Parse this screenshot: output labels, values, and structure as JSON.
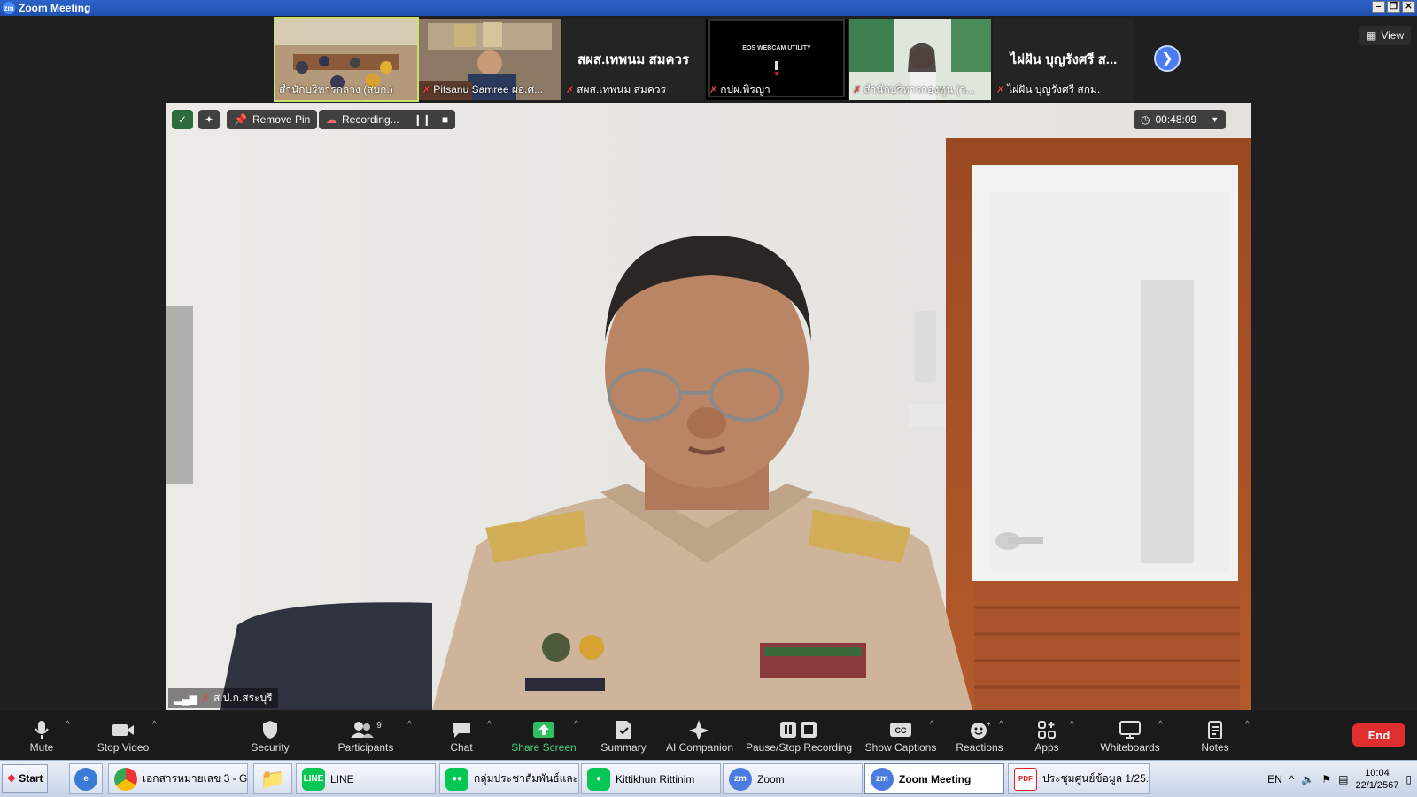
{
  "window": {
    "title": "Zoom Meeting",
    "logo": "zm"
  },
  "gallery": {
    "tiles": [
      {
        "name": "สำนักบริหารกลาง (สบก.)"
      },
      {
        "name": "Pitsanu Samree ผอ.ศ..."
      },
      {
        "name": "สผส.เทพนม สมควร",
        "big": "สผส.เทพนม สมควร"
      },
      {
        "name": "กปผ.พิรญา",
        "screen_text": "EOS WEBCAM UTILITY"
      },
      {
        "name": "สำนักบริหารกองทุน (ว..."
      },
      {
        "name": "ไผ่ฝัน บุญรังศรี สกม.",
        "big": "ไผ่ฝัน บุญรังศรี ส..."
      }
    ],
    "view_label": "View"
  },
  "video": {
    "remove_pin_label": "Remove Pin",
    "recording_label": "Recording...",
    "elapsed": "00:48:09",
    "speaker": "ส.ป.ก.สระบุรี"
  },
  "toolbar": {
    "mute": "Mute",
    "stop_video": "Stop Video",
    "security": "Security",
    "participants": "Participants",
    "participants_count": "9",
    "chat": "Chat",
    "share_screen": "Share Screen",
    "summary": "Summary",
    "ai_companion": "AI Companion",
    "pause_stop_recording": "Pause/Stop Recording",
    "show_captions": "Show Captions",
    "reactions": "Reactions",
    "apps": "Apps",
    "whiteboards": "Whiteboards",
    "notes": "Notes",
    "end": "End"
  },
  "taskbar": {
    "start": "Start",
    "items": [
      {
        "label": "เอกสารหมายเลข 3 - G..."
      },
      {
        "label": "LINE"
      },
      {
        "label": "กลุ่มประชาสัมพันธ์และ..."
      },
      {
        "label": "Kittikhun Rittinim"
      },
      {
        "label": "Zoom"
      },
      {
        "label": "Zoom Meeting"
      },
      {
        "label": "ประชุมศูนย์ข้อมูล 1/25..."
      }
    ],
    "lang": "EN",
    "time": "10:04",
    "date": "22/1/2567"
  }
}
